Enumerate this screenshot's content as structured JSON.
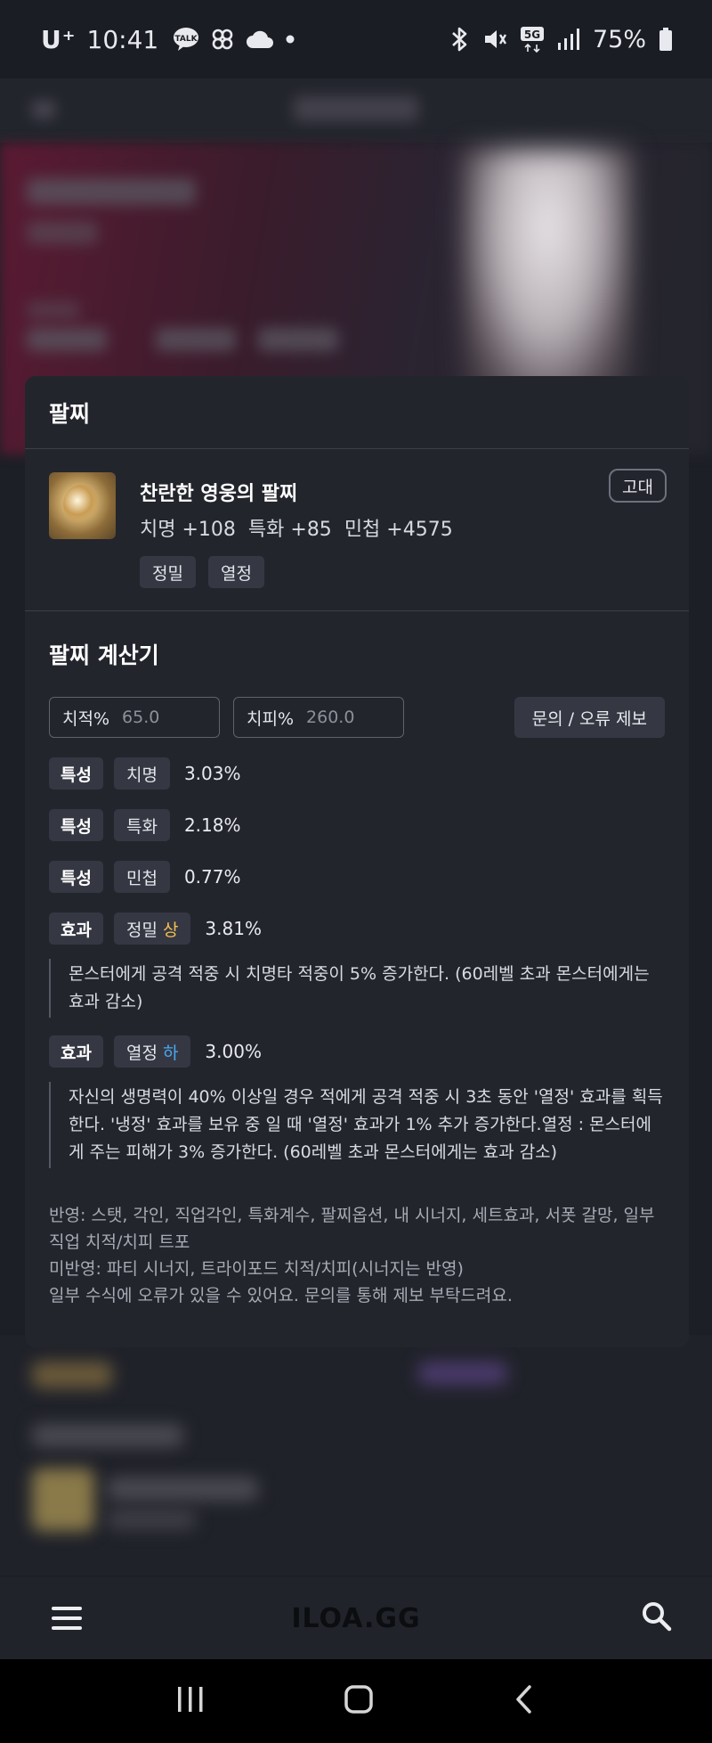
{
  "status_bar": {
    "carrier": "U⁺",
    "time": "10:41",
    "battery": "75%",
    "icons": [
      "talk-icon",
      "pinwheel-icon",
      "cloud-icon",
      "dot-icon",
      "bluetooth-icon",
      "mute-icon",
      "5g-icon",
      "signal-icon",
      "battery-icon"
    ]
  },
  "card": {
    "title": "팔찌",
    "item": {
      "name": "찬란한 영웅의 팔찌",
      "grade": "고대",
      "stats": [
        "치명 +108",
        "특화 +85",
        "민첩 +4575"
      ],
      "tags": [
        "정밀",
        "열정"
      ]
    },
    "calculator": {
      "title": "팔찌 계산기",
      "crit_rate": {
        "label": "치적%",
        "value": "65.0"
      },
      "crit_damage": {
        "label": "치피%",
        "value": "260.0"
      },
      "report_label": "문의 / 오류 제보",
      "rows": [
        {
          "kind": "특성",
          "name": "치명",
          "value": "3.03%"
        },
        {
          "kind": "특성",
          "name": "특화",
          "value": "2.18%"
        },
        {
          "kind": "특성",
          "name": "민첩",
          "value": "0.77%"
        }
      ],
      "effects": [
        {
          "kind": "효과",
          "name": "정밀",
          "level": "상",
          "value": "3.81%",
          "description": "몬스터에게 공격 적중 시 치명타 적중이 5% 증가한다. (60레벨 초과 몬스터에게는 효과 감소)"
        },
        {
          "kind": "효과",
          "name": "열정",
          "level": "하",
          "value": "3.00%",
          "description": "자신의 생명력이 40% 이상일 경우 적에게 공격 적중 시 3초 동안 '열정' 효과를 획득한다. '냉정' 효과를 보유 중 일 때 '열정' 효과가 1% 추가 증가한다.열정 : 몬스터에게 주는 피해가 3% 증가한다. (60레벨 초과 몬스터에게는 효과 감소)"
        }
      ],
      "notes": [
        "반영: 스탯, 각인, 직업각인, 특화계수, 팔찌옵션, 내 시너지, 세트효과, 서폿 갈망, 일부 직업 치적/치피 트포",
        "미반영: 파티 시너지, 트라이포드 치적/치피(시너지는 반영)",
        "일부 수식에 오류가 있을 수 있어요. 문의를 통해 제보 부탁드려요."
      ]
    }
  },
  "app_bar": {
    "brand": "ILOA.GG",
    "menu_icon": "hamburger-menu-icon",
    "search_icon": "search-icon"
  },
  "nav_bar": {
    "icons": [
      "recents-icon",
      "home-icon",
      "back-icon"
    ]
  },
  "colors": {
    "background": "#1d1f26",
    "card": "#23252d",
    "chip": "#353843",
    "level_high": "#f2c14e",
    "level_low": "#4aa8f0"
  }
}
